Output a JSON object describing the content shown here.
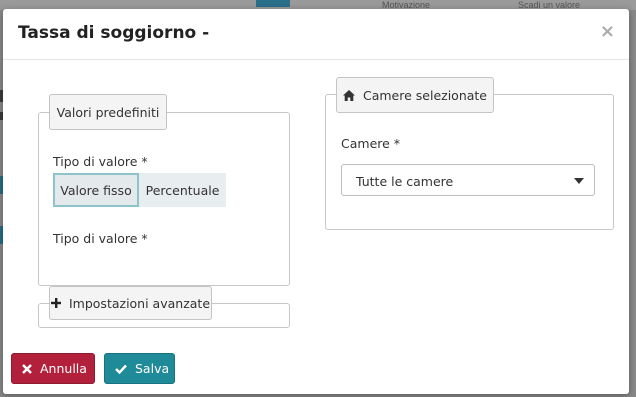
{
  "background": {
    "col1": "Motivazione",
    "col2": "Scadi un valore"
  },
  "modal": {
    "title": "Tassa di soggiorno -",
    "close_glyph": "×"
  },
  "left_panel": {
    "legend": "Valori predefiniti",
    "type_label": "Tipo di valore  *",
    "options": [
      {
        "label": "Valore fisso",
        "selected": true
      },
      {
        "label": "Percentuale",
        "selected": false
      }
    ],
    "type_label_2": "Tipo di valore *"
  },
  "advanced": {
    "label": "Impostazioni avanzate",
    "icon": "plus-icon"
  },
  "right_panel": {
    "legend": "Camere selezionate",
    "icon": "home-icon",
    "rooms_label": "Camere  *",
    "rooms_value": "Tutte le camere"
  },
  "footer": {
    "cancel_label": "Annulla",
    "cancel_icon": "close-icon",
    "save_label": "Salva",
    "save_icon": "check-icon"
  },
  "colors": {
    "cancel": "#b3203b",
    "save": "#1f8a98",
    "selected_border": "#8fc3cc"
  }
}
